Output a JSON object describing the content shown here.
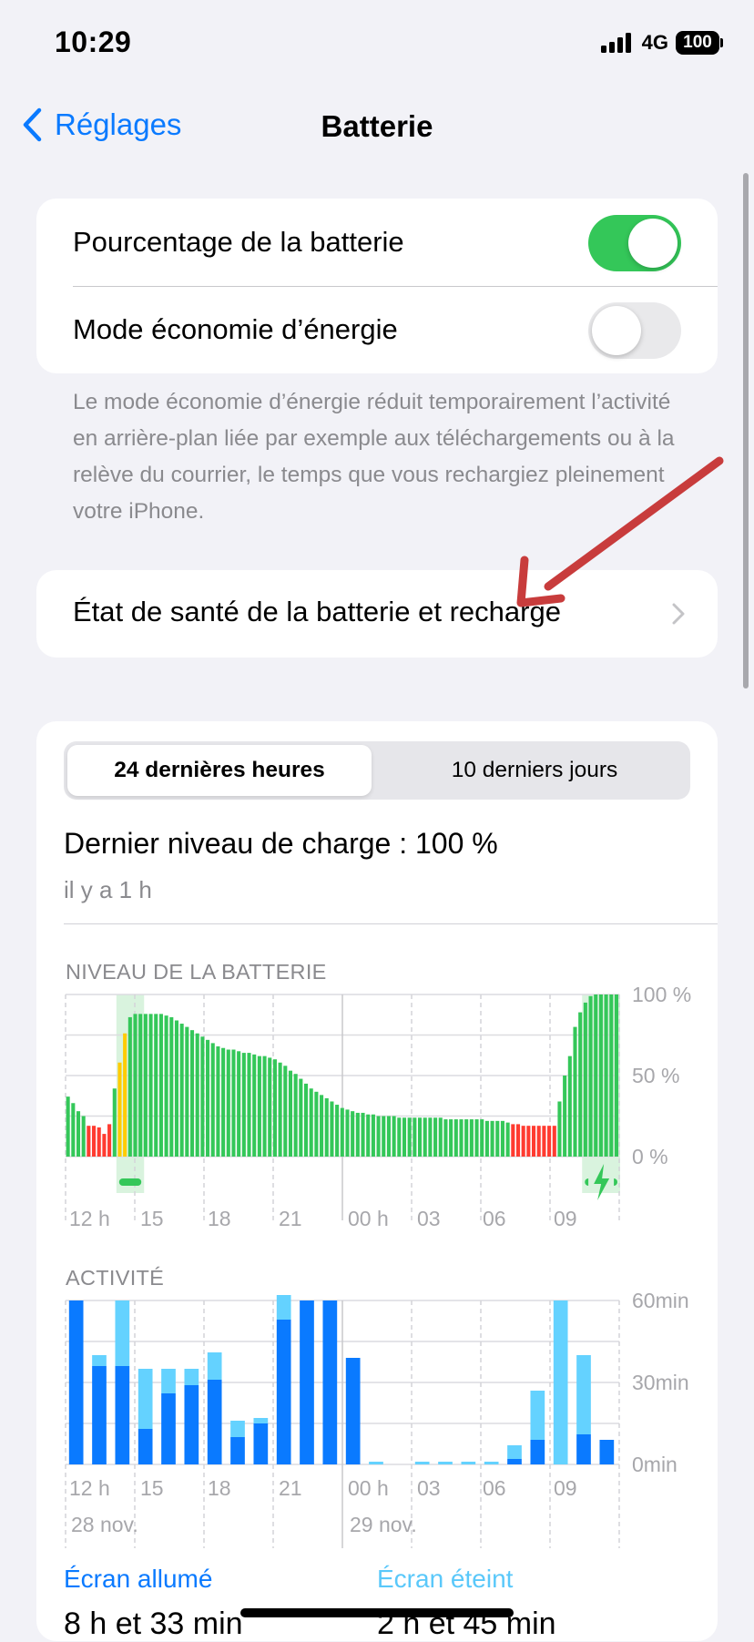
{
  "status": {
    "time": "10:29",
    "network": "4G",
    "battery": "100"
  },
  "nav": {
    "back_label": "Réglages",
    "title": "Batterie"
  },
  "settings": {
    "battery_percentage_label": "Pourcentage de la batterie",
    "battery_percentage_on": true,
    "low_power_label": "Mode économie d’énergie",
    "low_power_on": false,
    "footnote": "Le mode économie d’énergie réduit temporairement l’activité en arrière-plan liée par exemple aux téléchargements ou à la relève du courrier, le temps que vous rechargiez pleinement votre iPhone.",
    "health_label": "État de santé de la batterie et recharge"
  },
  "usage": {
    "tabs": [
      "24 dernières heures",
      "10 derniers jours"
    ],
    "active_tab": 0,
    "last_charge": "Dernier niveau de charge : 100 %",
    "last_charge_ago": "il y a 1 h",
    "battery_level_title": "NIVEAU DE LA BATTERIE",
    "activity_title": "ACTIVITÉ",
    "screen_on_label": "Écran allumé",
    "screen_on_value": "8 h et 33 min",
    "screen_off_label": "Écran éteint",
    "screen_off_value": "2 h et 45 min"
  },
  "colors": {
    "accent": "#0a7aff",
    "green": "#34c759",
    "red": "#ff3b30",
    "yellow": "#ffcc00",
    "activity_on": "#0a7aff",
    "activity_off": "#64d2ff",
    "annotation_arrow": "#c83c3c"
  },
  "chart_data": [
    {
      "type": "bar",
      "title": "NIVEAU DE LA BATTERIE",
      "x_ticks": [
        "12 h",
        "15",
        "18",
        "21",
        "00 h",
        "03",
        "06",
        "09"
      ],
      "y_ticks": [
        "100 %",
        "50 %",
        "0 %"
      ],
      "ylim": [
        0,
        100
      ],
      "unit": "%",
      "values": [
        37,
        33,
        28,
        25,
        19,
        19,
        18,
        14,
        20,
        42,
        58,
        76,
        86,
        88,
        88,
        88,
        88,
        88,
        88,
        87,
        86,
        84,
        82,
        80,
        78,
        76,
        74,
        72,
        70,
        68,
        67,
        66,
        66,
        65,
        64,
        64,
        63,
        62,
        62,
        61,
        60,
        58,
        56,
        53,
        51,
        48,
        45,
        42,
        40,
        38,
        36,
        34,
        32,
        30,
        29,
        28,
        27,
        27,
        26,
        26,
        25,
        25,
        25,
        25,
        24,
        24,
        24,
        24,
        24,
        24,
        24,
        24,
        24,
        23,
        23,
        23,
        23,
        23,
        23,
        23,
        23,
        22,
        22,
        22,
        22,
        21,
        20,
        20,
        19,
        19,
        19,
        19,
        19,
        19,
        19,
        34,
        50,
        62,
        80,
        89,
        95,
        99,
        100,
        100,
        100,
        100,
        100
      ],
      "low_threshold": 20,
      "charging_ranges": [
        [
          10,
          15
        ],
        [
          100,
          107
        ]
      ]
    },
    {
      "type": "bar",
      "title": "ACTIVITÉ",
      "x_ticks": [
        "12 h",
        "15",
        "18",
        "21",
        "00 h",
        "03",
        "06",
        "09"
      ],
      "date_labels": [
        "28 nov.",
        "29 nov."
      ],
      "y_ticks": [
        "60min",
        "30min",
        "0min"
      ],
      "ylim": [
        0,
        60
      ],
      "unit": "min",
      "series": [
        {
          "name": "Écran allumé",
          "values": [
            60,
            36,
            36,
            13,
            26,
            29,
            31,
            10,
            15,
            53,
            60,
            60,
            39,
            0,
            0,
            0,
            0,
            0,
            0,
            2,
            9,
            0,
            11,
            9
          ]
        },
        {
          "name": "Écran éteint",
          "values": [
            0,
            4,
            24,
            22,
            9,
            6,
            10,
            6,
            2,
            9,
            0,
            0,
            0,
            1,
            0,
            1,
            1,
            1,
            1,
            5,
            18,
            60,
            29,
            0
          ]
        }
      ]
    }
  ]
}
